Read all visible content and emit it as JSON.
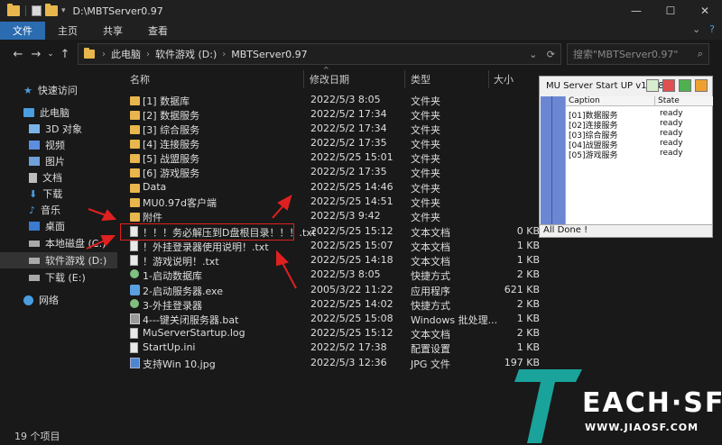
{
  "window": {
    "title": "D:\\MBTServer0.97",
    "controls": [
      "minimize",
      "maximize",
      "close"
    ]
  },
  "ribbon": {
    "tabs": [
      {
        "label": "文件",
        "active": true
      },
      {
        "label": "主页",
        "active": false
      },
      {
        "label": "共享",
        "active": false
      },
      {
        "label": "查看",
        "active": false
      }
    ],
    "right_chevron": "⌄",
    "help": "?"
  },
  "address": {
    "crumbs": [
      "此电脑",
      "软件游戏 (D:)",
      "MBTServer0.97"
    ],
    "search_placeholder": "搜索\"MBTServer0.97\""
  },
  "sidebar": {
    "items": [
      {
        "label": "快速访问",
        "icon": "star-icon"
      },
      {
        "label": "此电脑",
        "icon": "pc-icon"
      },
      {
        "label": "3D 对象",
        "icon": "3d-objects-icon"
      },
      {
        "label": "视频",
        "icon": "video-icon"
      },
      {
        "label": "图片",
        "icon": "picture-icon"
      },
      {
        "label": "文档",
        "icon": "document-icon"
      },
      {
        "label": "下载",
        "icon": "download-icon"
      },
      {
        "label": "音乐",
        "icon": "music-icon"
      },
      {
        "label": "桌面",
        "icon": "desktop-icon"
      },
      {
        "label": "本地磁盘 (C:)",
        "icon": "drive-icon"
      },
      {
        "label": "软件游戏 (D:)",
        "icon": "drive-icon",
        "selected": true
      },
      {
        "label": "下载 (E:)",
        "icon": "drive-icon"
      },
      {
        "label": "网络",
        "icon": "network-icon"
      }
    ]
  },
  "columns": {
    "name": "名称",
    "date": "修改日期",
    "type": "类型",
    "size": "大小"
  },
  "files": [
    {
      "name": "[1] 数据库",
      "date": "2022/5/3 8:05",
      "type": "文件夹",
      "size": "",
      "kind": "folder"
    },
    {
      "name": "[2] 数据服务",
      "date": "2022/5/2 17:34",
      "type": "文件夹",
      "size": "",
      "kind": "folder"
    },
    {
      "name": "[3] 综合服务",
      "date": "2022/5/2 17:34",
      "type": "文件夹",
      "size": "",
      "kind": "folder"
    },
    {
      "name": "[4] 连接服务",
      "date": "2022/5/2 17:35",
      "type": "文件夹",
      "size": "",
      "kind": "folder"
    },
    {
      "name": "[5] 战盟服务",
      "date": "2022/5/25 15:01",
      "type": "文件夹",
      "size": "",
      "kind": "folder"
    },
    {
      "name": "[6] 游戏服务",
      "date": "2022/5/2 17:35",
      "type": "文件夹",
      "size": "",
      "kind": "folder"
    },
    {
      "name": "Data",
      "date": "2022/5/25 14:46",
      "type": "文件夹",
      "size": "",
      "kind": "folder"
    },
    {
      "name": "MU0.97d客户端",
      "date": "2022/5/25 14:51",
      "type": "文件夹",
      "size": "",
      "kind": "folder"
    },
    {
      "name": "附件",
      "date": "2022/5/3 9:42",
      "type": "文件夹",
      "size": "",
      "kind": "folder"
    },
    {
      "name": "！！！务必解压到D盘根目录！！！.txt",
      "date": "2022/5/25 15:12",
      "type": "文本文档",
      "size": "0 KB",
      "kind": "txt"
    },
    {
      "name": "！外挂登录器使用说明！.txt",
      "date": "2022/5/25 15:07",
      "type": "文本文档",
      "size": "1 KB",
      "kind": "txt"
    },
    {
      "name": "！游戏说明！.txt",
      "date": "2022/5/25 14:18",
      "type": "文本文档",
      "size": "1 KB",
      "kind": "txt"
    },
    {
      "name": "1-启动数据库",
      "date": "2022/5/3 8:05",
      "type": "快捷方式",
      "size": "2 KB",
      "kind": "lnk"
    },
    {
      "name": "2-启动服务器.exe",
      "date": "2005/3/22 11:22",
      "type": "应用程序",
      "size": "621 KB",
      "kind": "app"
    },
    {
      "name": "3-外挂登录器",
      "date": "2022/5/25 14:02",
      "type": "快捷方式",
      "size": "2 KB",
      "kind": "lnk"
    },
    {
      "name": "4---键关闭服务器.bat",
      "date": "2022/5/25 15:08",
      "type": "Windows 批处理...",
      "size": "1 KB",
      "kind": "bat"
    },
    {
      "name": "MuServerStartup.log",
      "date": "2022/5/25 15:12",
      "type": "文本文档",
      "size": "2 KB",
      "kind": "txt"
    },
    {
      "name": "StartUp.ini",
      "date": "2022/5/2 17:38",
      "type": "配置设置",
      "size": "1 KB",
      "kind": "txt"
    },
    {
      "name": "支持Win 10.jpg",
      "date": "2022/5/3 12:36",
      "type": "JPG 文件",
      "size": "197 KB",
      "kind": "img"
    }
  ],
  "mu_window": {
    "title": "MU Server Start UP v1.2.8",
    "headers": {
      "caption": "Caption",
      "state": "State"
    },
    "rows": [
      {
        "caption": "[01]数据服务",
        "state": "ready"
      },
      {
        "caption": "[02]连接服务",
        "state": "ready"
      },
      {
        "caption": "[03]综合服务",
        "state": "ready"
      },
      {
        "caption": "[04]战盟服务",
        "state": "ready"
      },
      {
        "caption": "[05]游戏服务",
        "state": "ready"
      }
    ],
    "status": "All Done !"
  },
  "status_bar": {
    "count": "19 个项目"
  },
  "watermark": {
    "brand": "EACH·SF",
    "url": "WWW.JIAOSF.COM"
  },
  "colors": {
    "accent": "#2b6cb0",
    "folder": "#e8b64c",
    "highlight_red": "#e02020",
    "watermark_teal": "#1aa39a"
  }
}
